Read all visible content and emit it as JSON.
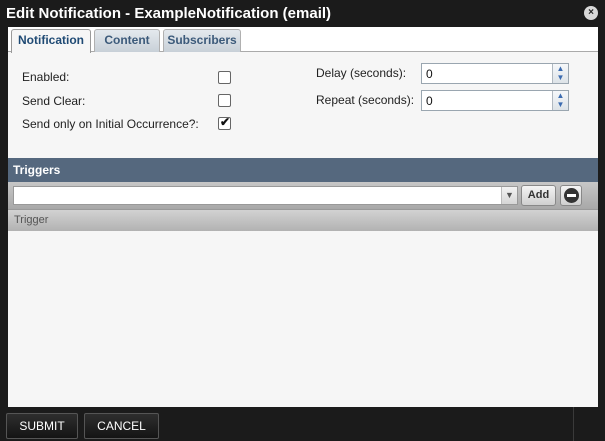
{
  "dialog": {
    "title": "Edit Notification - ExampleNotification (email)",
    "close_glyph": "×"
  },
  "tabs": [
    {
      "label": "Notification",
      "active": true
    },
    {
      "label": "Content",
      "active": false
    },
    {
      "label": "Subscribers",
      "active": false
    }
  ],
  "form": {
    "enabled_label": "Enabled:",
    "enabled_checked": false,
    "send_clear_label": "Send Clear:",
    "send_clear_checked": false,
    "initial_occurrence_label": "Send only on Initial Occurrence?:",
    "initial_occurrence_checked": true,
    "check_glyph": "✔",
    "delay_label": "Delay (seconds):",
    "delay_value": "0",
    "repeat_label": "Repeat (seconds):",
    "repeat_value": "0",
    "spinner_up": "▲",
    "spinner_down": "▼"
  },
  "triggers": {
    "header": "Triggers",
    "trigger_select_value": "",
    "dropdown_glyph": "▼",
    "add_label": "Add",
    "column_header": "Trigger"
  },
  "footer": {
    "submit_label": "SUBMIT",
    "cancel_label": "CANCEL"
  },
  "colors": {
    "titlebar": "#1b1b1b",
    "panel_header": "#55687e",
    "tab_text": "#3c5a7a"
  }
}
